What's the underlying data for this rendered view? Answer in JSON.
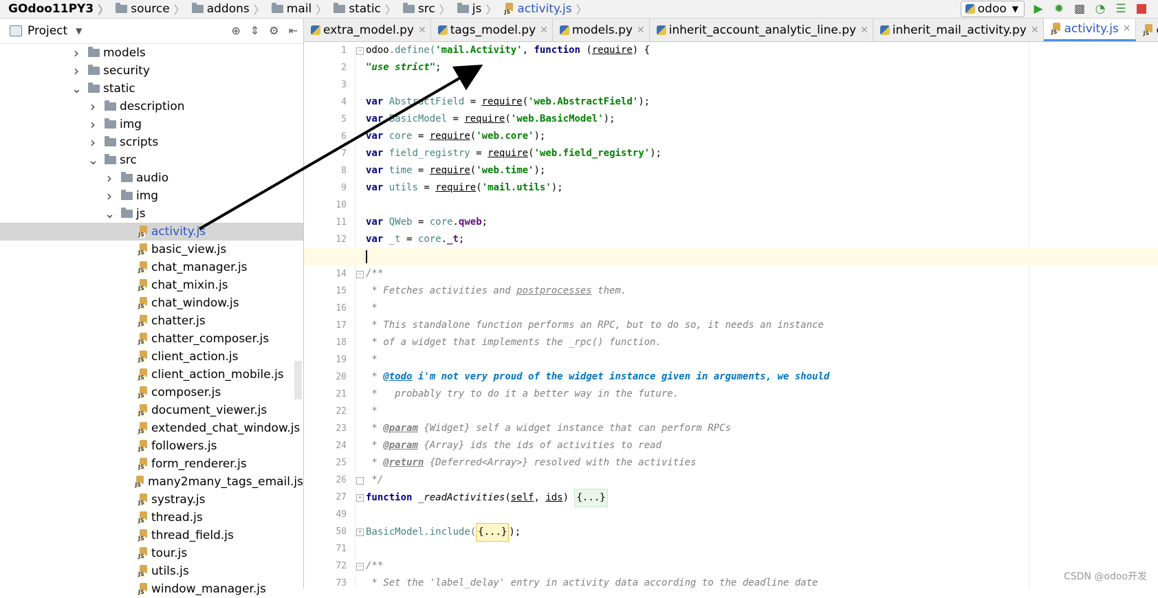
{
  "breadcrumb": [
    "GOdoo11PY3",
    "source",
    "addons",
    "mail",
    "static",
    "src",
    "js",
    "activity.js"
  ],
  "run_config": "odoo",
  "project": {
    "title": "Project"
  },
  "tree": [
    {
      "label": "models",
      "depth": 0,
      "expanded": false,
      "type": "folder"
    },
    {
      "label": "security",
      "depth": 0,
      "expanded": false,
      "type": "folder"
    },
    {
      "label": "static",
      "depth": 0,
      "expanded": true,
      "type": "folder"
    },
    {
      "label": "description",
      "depth": 1,
      "expanded": false,
      "type": "folder"
    },
    {
      "label": "img",
      "depth": 1,
      "expanded": false,
      "type": "folder"
    },
    {
      "label": "scripts",
      "depth": 1,
      "expanded": false,
      "type": "folder"
    },
    {
      "label": "src",
      "depth": 1,
      "expanded": true,
      "type": "folder"
    },
    {
      "label": "audio",
      "depth": 2,
      "expanded": false,
      "type": "folder"
    },
    {
      "label": "img",
      "depth": 2,
      "expanded": false,
      "type": "folder"
    },
    {
      "label": "js",
      "depth": 2,
      "expanded": true,
      "type": "folder"
    },
    {
      "label": "activity.js",
      "depth": 3,
      "type": "js",
      "selected": true
    },
    {
      "label": "basic_view.js",
      "depth": 3,
      "type": "js"
    },
    {
      "label": "chat_manager.js",
      "depth": 3,
      "type": "js"
    },
    {
      "label": "chat_mixin.js",
      "depth": 3,
      "type": "js"
    },
    {
      "label": "chat_window.js",
      "depth": 3,
      "type": "js"
    },
    {
      "label": "chatter.js",
      "depth": 3,
      "type": "js"
    },
    {
      "label": "chatter_composer.js",
      "depth": 3,
      "type": "js"
    },
    {
      "label": "client_action.js",
      "depth": 3,
      "type": "js"
    },
    {
      "label": "client_action_mobile.js",
      "depth": 3,
      "type": "js"
    },
    {
      "label": "composer.js",
      "depth": 3,
      "type": "js"
    },
    {
      "label": "document_viewer.js",
      "depth": 3,
      "type": "js"
    },
    {
      "label": "extended_chat_window.js",
      "depth": 3,
      "type": "js"
    },
    {
      "label": "followers.js",
      "depth": 3,
      "type": "js"
    },
    {
      "label": "form_renderer.js",
      "depth": 3,
      "type": "js"
    },
    {
      "label": "many2many_tags_email.js",
      "depth": 3,
      "type": "js"
    },
    {
      "label": "systray.js",
      "depth": 3,
      "type": "js"
    },
    {
      "label": "thread.js",
      "depth": 3,
      "type": "js"
    },
    {
      "label": "thread_field.js",
      "depth": 3,
      "type": "js"
    },
    {
      "label": "tour.js",
      "depth": 3,
      "type": "js"
    },
    {
      "label": "utils.js",
      "depth": 3,
      "type": "js"
    },
    {
      "label": "window_manager.js",
      "depth": 3,
      "type": "js"
    }
  ],
  "tabs": [
    {
      "label": "extra_model.py",
      "type": "py"
    },
    {
      "label": "tags_model.py",
      "type": "py"
    },
    {
      "label": "models.py",
      "type": "py"
    },
    {
      "label": "inherit_account_analytic_line.py",
      "type": "py"
    },
    {
      "label": "inherit_mail_activity.py",
      "type": "py"
    },
    {
      "label": "activity.js",
      "type": "js",
      "active": true
    },
    {
      "label": "extend_email",
      "type": "js"
    }
  ],
  "line_numbers": [
    "1",
    "2",
    "3",
    "4",
    "5",
    "6",
    "7",
    "8",
    "9",
    "10",
    "11",
    "12",
    "13",
    "14",
    "15",
    "16",
    "17",
    "18",
    "19",
    "20",
    "21",
    "22",
    "23",
    "24",
    "25",
    "26",
    "27",
    "49",
    "50",
    "71",
    "72",
    "73"
  ],
  "code": {
    "l1": [
      "odoo",
      ".define(",
      "'mail.Activity'",
      ", ",
      "function",
      " (",
      "require",
      ") {"
    ],
    "l2": "\"use strict\"",
    "l2b": ";",
    "vars": [
      {
        "kw": "var",
        "name": "AbstractField",
        "mod": "'web.AbstractField'"
      },
      {
        "kw": "var",
        "name": "BasicModel",
        "mod": "'web.BasicModel'"
      },
      {
        "kw": "var",
        "name": "core",
        "mod": "'web.core'"
      },
      {
        "kw": "var",
        "name": "field_registry",
        "mod": "'web.field_registry'"
      },
      {
        "kw": "var",
        "name": "time",
        "mod": "'web.time'"
      },
      {
        "kw": "var",
        "name": "utils",
        "mod": "'mail.utils'"
      }
    ],
    "require": "require",
    "l11": [
      "var",
      " QWeb",
      " = ",
      "core",
      ".",
      "qweb",
      ";"
    ],
    "l12": [
      "var",
      " _t",
      " = ",
      "core",
      ".",
      "_t",
      ";"
    ],
    "c14": "/**",
    "c15a": " * Fetches activities and ",
    "c15b": "postprocesses",
    "c15c": " them.",
    "c16": " *",
    "c17": " * This standalone function performs an RPC, but to do so, it needs an instance",
    "c18": " * of a widget that implements the _rpc() function.",
    "c19": " *",
    "c20a": " * ",
    "c20b": "@todo",
    "c20c": " i'm not very proud of the widget instance given in arguments, we should",
    "c21": " *   probably try to do it a better way in the future.",
    "c22": " *",
    "c23a": " * ",
    "c23b": "@param",
    "c23c": " {Widget} self a widget instance that can perform RPCs",
    "c24a": " * ",
    "c24b": "@param",
    "c24c": " {Array} ids the ids of activities to read",
    "c25a": " * ",
    "c25b": "@return",
    "c25c": " {Deferred<Array>} resolved with the activities",
    "c26": " */",
    "l27": [
      "function",
      " _readActivities",
      "(",
      "self",
      ", ",
      "ids",
      ") ",
      "{...}"
    ],
    "l50": [
      "BasicModel",
      ".include(",
      "{...}",
      ");"
    ],
    "c72": "/**",
    "c73": " * Set the 'label_delay' entry in activity data according to the deadline date"
  },
  "watermark": "CSDN @odoo开发"
}
